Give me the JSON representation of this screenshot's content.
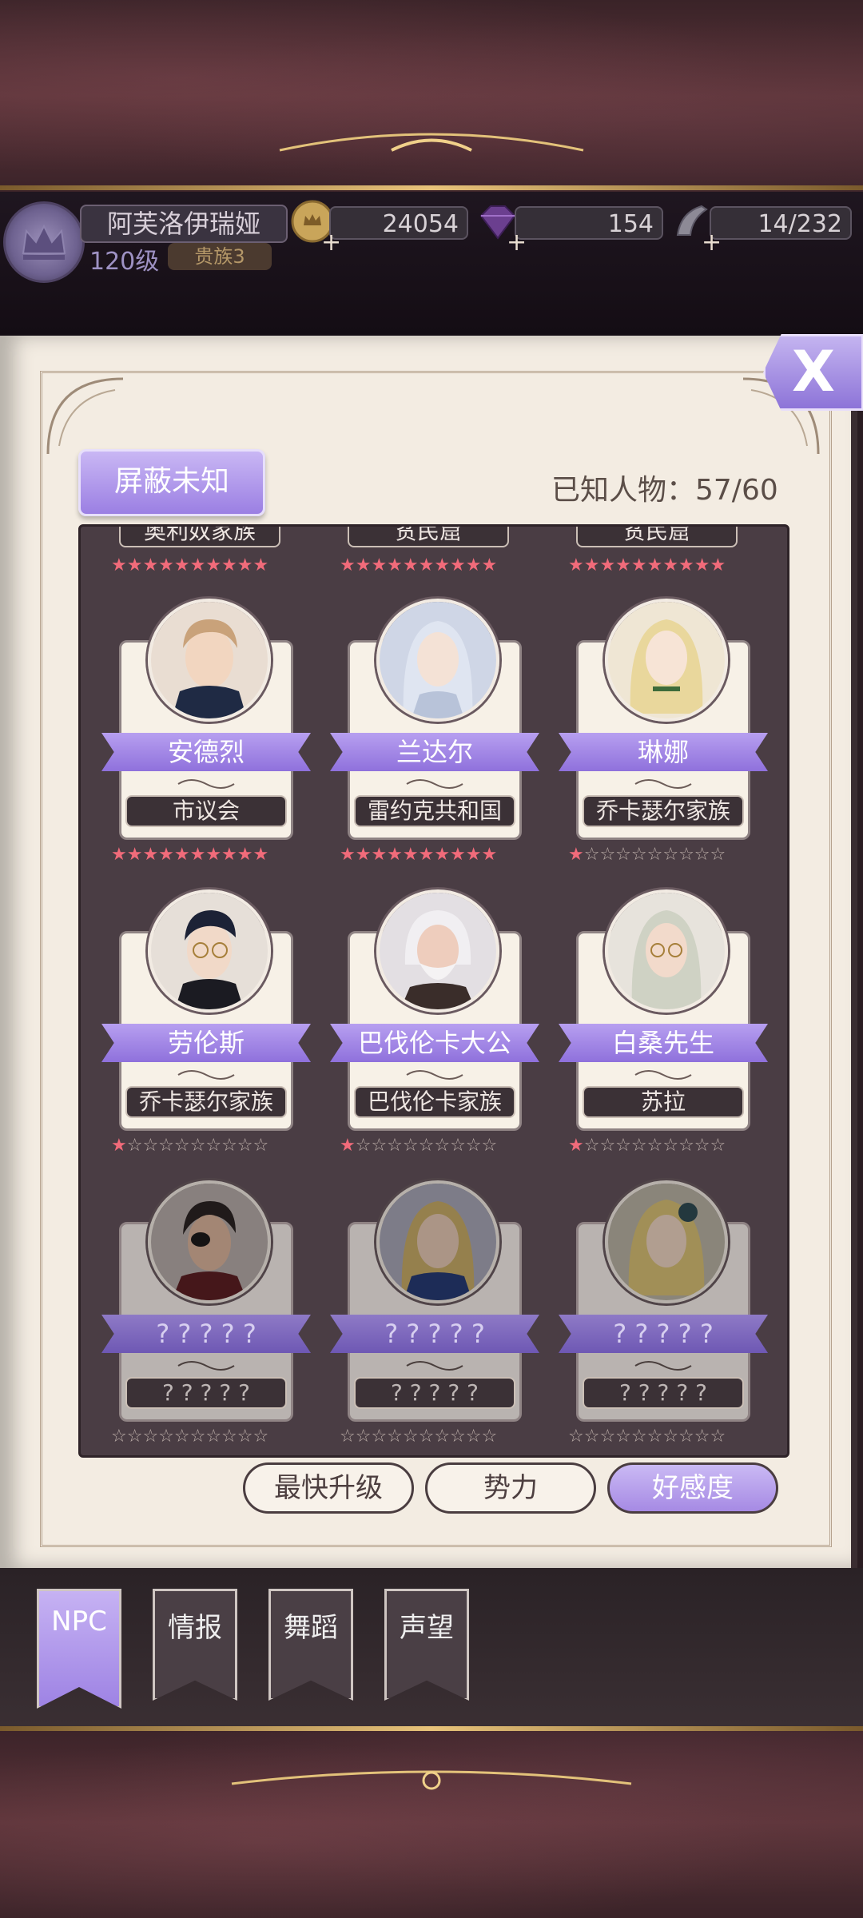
{
  "player": {
    "name": "阿芙洛伊瑞娅",
    "level": "120级",
    "rank": "贵族3"
  },
  "currencies": {
    "gold": "24054",
    "gems": "154",
    "stamina": "14/232"
  },
  "header": {
    "filter_button": "屏蔽未知",
    "known_label": "已知人物：57/60",
    "close_label": "X"
  },
  "grid": {
    "partial_top": [
      "奥利奴家族",
      "贫民窟",
      "贫民窟"
    ],
    "cards": [
      {
        "name": "安德烈",
        "faction": "市议会",
        "stars": 10,
        "locked": false
      },
      {
        "name": "兰达尔",
        "faction": "雷约克共和国",
        "stars": 10,
        "locked": false
      },
      {
        "name": "琳娜",
        "faction": "乔卡瑟尔家族",
        "stars": 1,
        "locked": false
      },
      {
        "name": "劳伦斯",
        "faction": "乔卡瑟尔家族",
        "stars": 1,
        "locked": false
      },
      {
        "name": "巴伐伦卡大公",
        "faction": "巴伐伦卡家族",
        "stars": 1,
        "locked": false
      },
      {
        "name": "白桑先生",
        "faction": "苏拉",
        "stars": 1,
        "locked": false
      },
      {
        "name": "? ? ? ? ?",
        "faction": "? ? ? ? ?",
        "stars": 0,
        "locked": true
      },
      {
        "name": "? ? ? ? ?",
        "faction": "? ? ? ? ?",
        "stars": 0,
        "locked": true
      },
      {
        "name": "? ? ? ? ?",
        "faction": "? ? ? ? ?",
        "stars": 0,
        "locked": true
      }
    ]
  },
  "sort": {
    "fastest_upgrade": "最快升级",
    "faction": "势力",
    "affinity": "好感度"
  },
  "tabs": [
    "NPC",
    "情报",
    "舞蹈",
    "声望"
  ],
  "colors": {
    "accent": "#9b7fe3",
    "star_on": "#f16b7a",
    "panel": "#4a3d44"
  }
}
